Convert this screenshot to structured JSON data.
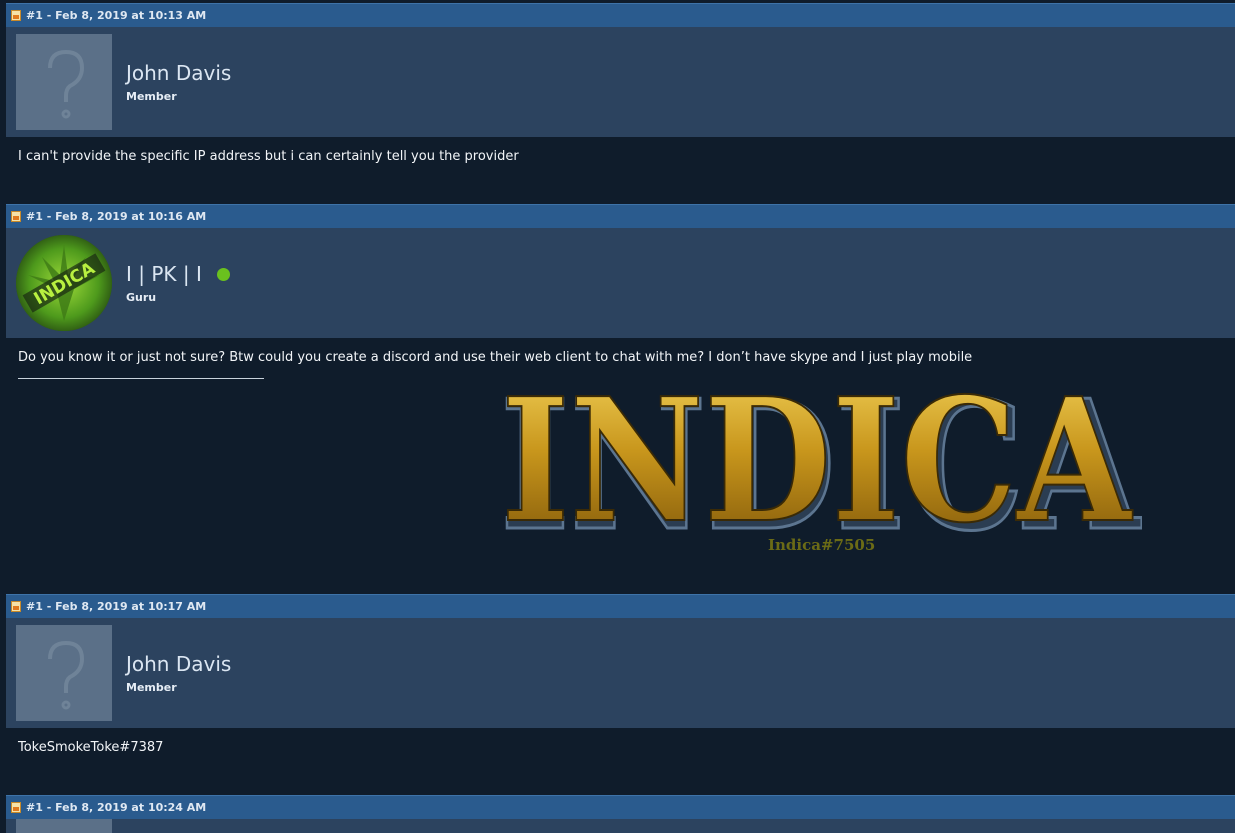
{
  "posts": [
    {
      "header": "#1 - Feb 8, 2019 at 10:13 AM",
      "username": "John Davis",
      "role": "Member",
      "body": "I can't provide the specific IP address but i can certainly tell you the provider"
    },
    {
      "header": "#1 - Feb 8, 2019 at 10:16 AM",
      "username": "I | PK | I",
      "role": "Guru",
      "body": "Do you know it or just not sure? Btw could you create a discord and use their web client to chat with me? I don’t have skype and I just play mobile",
      "signature": {
        "banner_text": "INDICA",
        "handle": "Indica#7505",
        "handle_color": "#6b6b16"
      },
      "avatar_text": "INDICA"
    },
    {
      "header": "#1 - Feb 8, 2019 at 10:17 AM",
      "username": "John Davis",
      "role": "Member",
      "body": "TokeSmokeToke#7387"
    },
    {
      "header": "#1 - Feb 8, 2019 at 10:24 AM"
    }
  ],
  "colors": {
    "header_bg": "#2a5b8e",
    "user_bg": "#2c435f",
    "body_bg": "#0f1c2b",
    "online": "#6ac11e"
  }
}
